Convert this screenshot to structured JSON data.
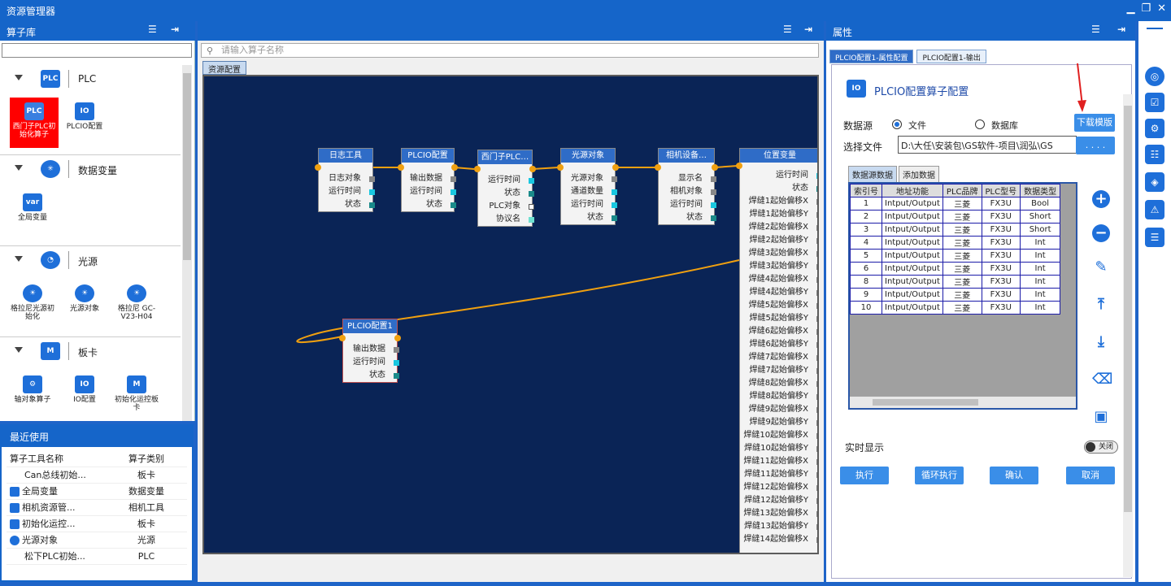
{
  "window": {
    "title": "资源管理器"
  },
  "left_panel": {
    "title": "算子库",
    "categories": [
      {
        "name": "PLC",
        "items": [
          "西门子PLC初始化算子",
          "PLCIO配置"
        ]
      },
      {
        "name": "数据变量",
        "items": [
          "全局变量"
        ]
      },
      {
        "name": "光源",
        "items": [
          "格拉尼光源初始化",
          "光源对象",
          "格拉尼 GC-V23-H04"
        ]
      },
      {
        "name": "板卡",
        "items": [
          "轴对象算子",
          "IO配置",
          "初始化运控板卡"
        ]
      }
    ],
    "selected_item": "西门子PLC初始化算子"
  },
  "recent": {
    "title": "最近使用",
    "headers": [
      "算子工具名称",
      "算子类别"
    ],
    "rows": [
      [
        "Can总线初始...",
        "板卡"
      ],
      [
        "全局变量",
        "数据变量"
      ],
      [
        "相机资源管...",
        "相机工具"
      ],
      [
        "初始化运控...",
        "板卡"
      ],
      [
        "光源对象",
        "光源"
      ],
      [
        "松下PLC初始...",
        "PLC"
      ]
    ]
  },
  "center": {
    "search_placeholder": "请输入算子名称",
    "tab": "资源配置",
    "nodes": [
      {
        "title": "日志工具",
        "rows": [
          "日志对象",
          "运行时间",
          "状态"
        ]
      },
      {
        "title": "PLCIO配置",
        "rows": [
          "输出数据",
          "运行时间",
          "状态"
        ]
      },
      {
        "title": "西门子PLC…",
        "rows": [
          "运行时间",
          "状态",
          "PLC对象",
          "协议名"
        ]
      },
      {
        "title": "光源对象",
        "rows": [
          "光源对象",
          "通道数量",
          "运行时间",
          "状态"
        ]
      },
      {
        "title": "相机设备…",
        "rows": [
          "显示名",
          "相机对象",
          "运行时间",
          "状态"
        ]
      },
      {
        "title": "位置变量",
        "rows": [
          "运行时间",
          "状态",
          "焊缝1起始偏移X",
          "焊缝1起始偏移Y",
          "焊缝2起始偏移X",
          "焊缝2起始偏移Y",
          "焊缝3起始偏移X",
          "焊缝3起始偏移Y",
          "焊缝4起始偏移X",
          "焊缝4起始偏移Y",
          "焊缝5起始偏移X",
          "焊缝5起始偏移Y",
          "焊缝6起始偏移X",
          "焊缝6起始偏移Y",
          "焊缝7起始偏移X",
          "焊缝7起始偏移Y",
          "焊缝8起始偏移X",
          "焊缝8起始偏移Y",
          "焊缝9起始偏移X",
          "焊缝9起始偏移Y",
          "焊缝10起始偏移X",
          "焊缝10起始偏移Y",
          "焊缝11起始偏移X",
          "焊缝11起始偏移Y",
          "焊缝12起始偏移X",
          "焊缝12起始偏移Y",
          "焊缝13起始偏移X",
          "焊缝13起始偏移Y",
          "焊缝14起始偏移X"
        ]
      },
      {
        "title": "PLCIO配置1",
        "rows": [
          "输出数据",
          "运行时间",
          "状态"
        ]
      }
    ]
  },
  "props": {
    "title": "属性",
    "tabs": [
      "PLCIO配置1-属性配置",
      "PLCIO配置1-输出"
    ],
    "header": "PLCIO配置算子配置",
    "datasource_label": "数据源",
    "radio_file": "文件",
    "radio_db": "数据库",
    "download_btn": "下载模版",
    "file_label": "选择文件",
    "file_path": "D:\\大任\\安装包\\GS软件-项目\\润弘\\GS",
    "browse_btn": ". . . .",
    "subtabs": [
      "数据源数据",
      "添加数据"
    ],
    "grid_headers": [
      "索引号",
      "地址功能",
      "PLC品牌",
      "PLC型号",
      "数据类型"
    ],
    "grid_rows": [
      [
        "1",
        "Intput/Output",
        "三菱",
        "FX3U",
        "Bool"
      ],
      [
        "2",
        "Intput/Output",
        "三菱",
        "FX3U",
        "Short"
      ],
      [
        "3",
        "Intput/Output",
        "三菱",
        "FX3U",
        "Short"
      ],
      [
        "4",
        "Intput/Output",
        "三菱",
        "FX3U",
        "Int"
      ],
      [
        "5",
        "Intput/Output",
        "三菱",
        "FX3U",
        "Int"
      ],
      [
        "6",
        "Intput/Output",
        "三菱",
        "FX3U",
        "Int"
      ],
      [
        "8",
        "Intput/Output",
        "三菱",
        "FX3U",
        "Int"
      ],
      [
        "9",
        "Intput/Output",
        "三菱",
        "FX3U",
        "Int"
      ],
      [
        "10",
        "Intput/Output",
        "三菱",
        "FX3U",
        "Int"
      ]
    ],
    "realtime_label": "实时显示",
    "toggle_text": "关闭",
    "buttons": [
      "执行",
      "循环执行",
      "确认",
      "取消"
    ]
  },
  "colors": {
    "accent": "#1565c9",
    "canvas": "#0a2456",
    "wire": "#f0a010"
  }
}
